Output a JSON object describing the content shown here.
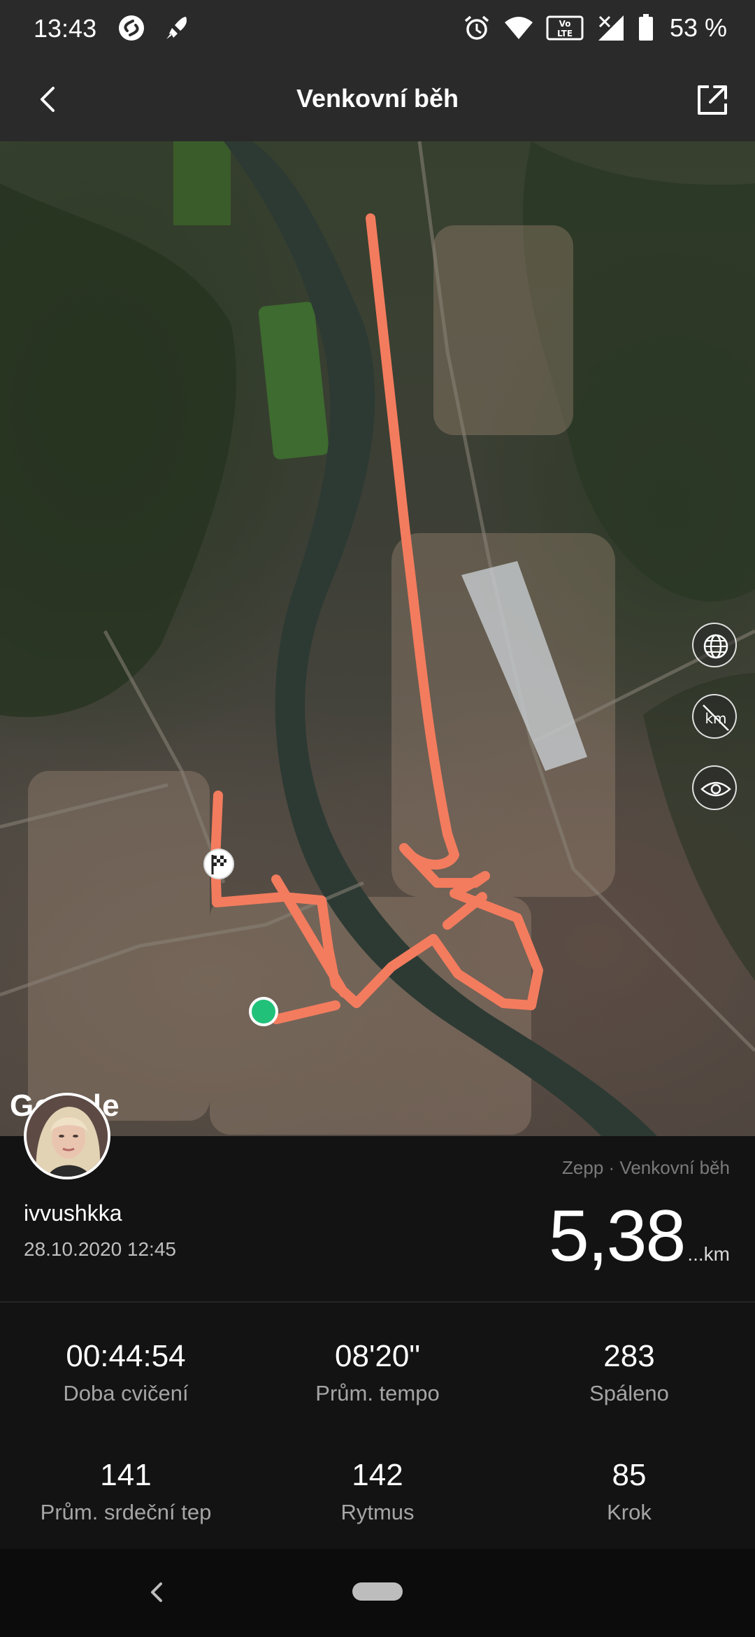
{
  "status_bar": {
    "time": "13:43",
    "battery_percent": "53 %",
    "icons": [
      "shazam-icon",
      "rocket-icon",
      "alarm-icon",
      "wifi-icon",
      "volte-icon",
      "signal-icon",
      "battery-icon"
    ]
  },
  "app_bar": {
    "title": "Venkovní běh",
    "back_icon": "chevron-left-icon",
    "share_icon": "share-external-icon"
  },
  "map": {
    "attribution": "Google",
    "route_color": "#f37c5e",
    "start_color": "#22c17a",
    "controls": [
      "globe-icon",
      "km-off-icon",
      "eye-icon"
    ]
  },
  "profile": {
    "username": "ivvushkka",
    "datetime": "28.10.2020 12:45",
    "source": "Zepp · Venkovní běh",
    "distance": "5,38",
    "distance_unit": "...km"
  },
  "stats": [
    {
      "value": "00:44:54",
      "label": "Doba cvičení"
    },
    {
      "value": "08'20\"",
      "label": "Prům. tempo"
    },
    {
      "value": "283",
      "label": "Spáleno"
    },
    {
      "value": "141",
      "label": "Prům. srdeční tep"
    },
    {
      "value": "142",
      "label": "Rytmus"
    },
    {
      "value": "85",
      "label": "Krok"
    }
  ]
}
